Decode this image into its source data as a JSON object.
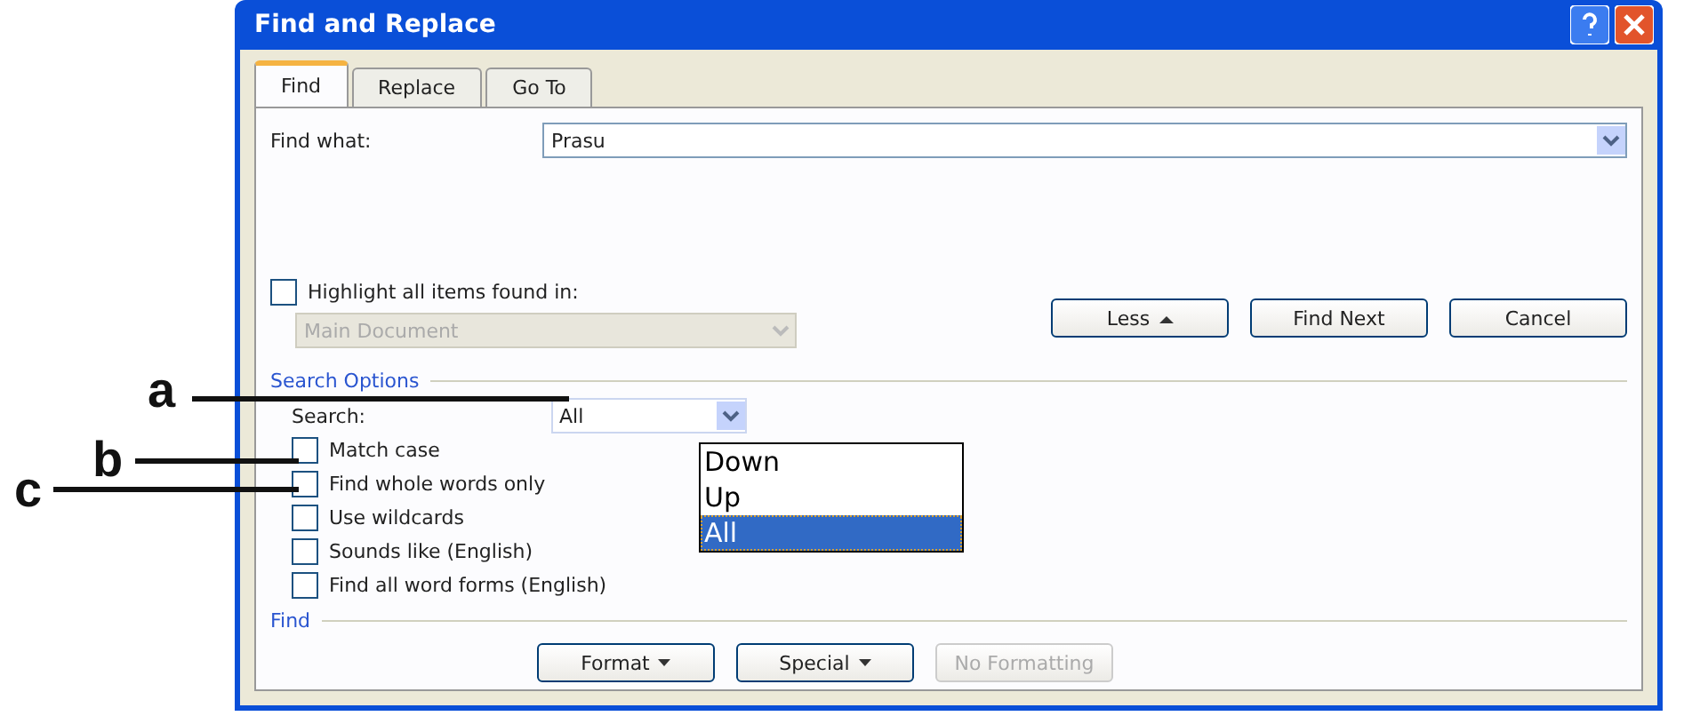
{
  "window": {
    "title": "Find and Replace"
  },
  "tabs": [
    {
      "label": "Find",
      "selected": true
    },
    {
      "label": "Replace",
      "selected": false
    },
    {
      "label": "Go To",
      "selected": false
    }
  ],
  "find_what": {
    "label": "Find what:",
    "value": "Prasu"
  },
  "highlight": {
    "label": "Highlight all items found in:",
    "checked": false,
    "scope": "Main Document",
    "disabled": true
  },
  "buttons": [
    {
      "label": "Less",
      "kind": "less"
    },
    {
      "label": "Find Next",
      "kind": "plain"
    },
    {
      "label": "Cancel",
      "kind": "plain"
    }
  ],
  "search_options": {
    "legend": "Search Options",
    "search_label": "Search:",
    "search_value": "All",
    "list": [
      {
        "label": "Down",
        "selected": false
      },
      {
        "label": "Up",
        "selected": false
      },
      {
        "label": "All",
        "selected": true
      }
    ],
    "options": [
      {
        "label": "Match case",
        "checked": false
      },
      {
        "label": "Find whole words only",
        "checked": false
      },
      {
        "label": "Use wildcards",
        "checked": false
      },
      {
        "label": "Sounds like (English)",
        "checked": false
      },
      {
        "label": "Find all word forms (English)",
        "checked": false
      }
    ]
  },
  "find_section": {
    "legend": "Find",
    "buttons": [
      {
        "label": "Format",
        "menu": true,
        "disabled": false
      },
      {
        "label": "Special",
        "menu": true,
        "disabled": false
      },
      {
        "label": "No Formatting",
        "menu": false,
        "disabled": true
      }
    ]
  },
  "callouts": [
    {
      "label": "a"
    },
    {
      "label": "b"
    },
    {
      "label": "c"
    }
  ]
}
